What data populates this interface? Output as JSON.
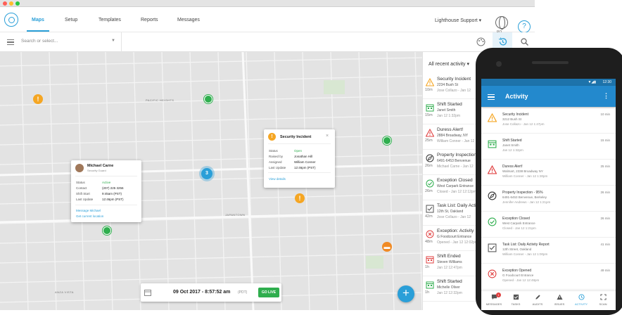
{
  "nav": {
    "items": [
      "Maps",
      "Setup",
      "Templates",
      "Reports",
      "Messages"
    ],
    "org": "Lighthouse Support",
    "globe_label": "PO",
    "help": "?"
  },
  "search": {
    "placeholder": "Search or select..."
  },
  "map": {
    "labels": [
      "PACIFIC HEIGHTS",
      "JAPANTOWN",
      "ANZA VISTA"
    ],
    "cluster_count": "3",
    "incident_popup": {
      "title": "Security Incident",
      "rows": [
        {
          "label": "Status",
          "value": "Open"
        },
        {
          "label": "Raised by",
          "value": "Jonathan Hill"
        },
        {
          "label": "Assigned",
          "value": "William Conner"
        },
        {
          "label": "Last Update",
          "value": "12:46pm (PST)"
        }
      ],
      "link": "View details"
    },
    "person_popup": {
      "name": "Michael Carne",
      "role": "Security Guard",
      "rows": [
        {
          "label": "Status",
          "value": "Active"
        },
        {
          "label": "Contact",
          "value": "(207) 225 3256"
        },
        {
          "label": "Shift Start",
          "value": "9:45am (PST)"
        },
        {
          "label": "Last Update",
          "value": "12:46pm (PST)"
        }
      ],
      "links": [
        "Message Michael",
        "Get current location"
      ]
    },
    "timebar": {
      "date": "09 Oct 2017 - 8:57:52 am",
      "tz": "(PDT)",
      "button": "GO LIVE"
    },
    "fab": "+"
  },
  "activity": {
    "filter": "All recent activity",
    "items": [
      {
        "icon": "warning",
        "color": "#f5a623",
        "title": "Security Incident",
        "sub": "2234 Bush St",
        "sub2": "Jose Collazo - Jan 12",
        "time": "10m"
      },
      {
        "icon": "shift",
        "color": "#2fae4e",
        "title": "Shift Started",
        "sub": "Janet Smith",
        "sub2": "Jan 12 1:32pm",
        "time": "15m"
      },
      {
        "icon": "warning",
        "color": "#e04040",
        "title": "Duress Alert!",
        "sub": "2884 Broadway, NY",
        "sub2": "William Conner - Jan 12",
        "time": "25m"
      },
      {
        "icon": "compass",
        "color": "#333333",
        "title": "Property Inspection",
        "sub": "6491-6453 Benvenue",
        "sub2": "Michael Carne - Jan 12",
        "time": "26m"
      },
      {
        "icon": "check-circle",
        "color": "#2fae4e",
        "title": "Exception Closed",
        "sub": "West Carpark Entrance",
        "sub2": "Closed - Jan 12 12:12pm",
        "time": "26m"
      },
      {
        "icon": "checkbox",
        "color": "#555555",
        "title": "Task List: Daily Activity",
        "sub": "12th St, Oakland",
        "sub2": "Jose Collazo - Jan 12",
        "time": "42m"
      },
      {
        "icon": "x-circle",
        "color": "#e04040",
        "title": "Exception: Activity",
        "sub": "G Foodcourt Entrance",
        "sub2": "Opened - Jan 12 12:02pm",
        "time": "48m"
      },
      {
        "icon": "shift",
        "color": "#e04040",
        "title": "Shift Ended",
        "sub": "Steven Williams",
        "sub2": "Jan 12 12:47pm",
        "time": "1h"
      },
      {
        "icon": "shift",
        "color": "#2fae4e",
        "title": "Shift Started",
        "sub": "Michelle Oliver",
        "sub2": "Jan 12 12:32pm",
        "time": "1h"
      }
    ]
  },
  "mobile": {
    "clock": "12:30",
    "title": "Activity",
    "items": [
      {
        "icon": "warning",
        "color": "#f5a623",
        "title": "Security Incident",
        "sub": "3212 Bush St",
        "sub2": "Jose Collazo - Jan 12 1:47pm",
        "time": "10 min"
      },
      {
        "icon": "shift",
        "color": "#2fae4e",
        "title": "Shift Started",
        "sub": "Janet Smith",
        "sub2": "Jan 12 1:32pm",
        "time": "15 min"
      },
      {
        "icon": "warning",
        "color": "#e04040",
        "title": "Duress Alert!",
        "sub": "Walmart, 2338 Broadway NY",
        "sub2": "William Conner - Jan 12 1:30pm",
        "time": "25 min"
      },
      {
        "icon": "compass",
        "color": "#333333",
        "title": "Property Inspection - 95%",
        "sub": "6491-6453 Benvenue, Berkeley",
        "sub2": "Jennifer Andrews - Jan 12 1:21pm",
        "time": "26 min"
      },
      {
        "icon": "check-circle",
        "color": "#2fae4e",
        "title": "Exception Closed",
        "sub": "West Carpark Entrance",
        "sub2": "Closed - Jan 12 1:21pm",
        "time": "26 min"
      },
      {
        "icon": "checkbox",
        "color": "#555555",
        "title": "Task List: Daily Activity Report",
        "sub": "12th Street, Oakland",
        "sub2": "William Conner - Jan 12 1:00pm",
        "time": "41 min"
      },
      {
        "icon": "x-circle",
        "color": "#e04040",
        "title": "Exception Opened",
        "sub": "G Foodcourt Entrance",
        "sub2": "Opened - Jan 12 12:48pm",
        "time": "49 min"
      }
    ],
    "bottom_nav": [
      {
        "icon": "messages-icon",
        "label": "MESSAGES",
        "badge": "1"
      },
      {
        "icon": "tasks-icon",
        "label": "TASKS"
      },
      {
        "icon": "audits-icon",
        "label": "AUDITS"
      },
      {
        "icon": "issues-icon",
        "label": "ISSUES"
      },
      {
        "icon": "activity-icon",
        "label": "ACTIVITY",
        "active": true
      },
      {
        "icon": "scan-icon",
        "label": "SCAN"
      }
    ]
  },
  "colors": {
    "accent": "#2a9fd8",
    "success": "#2fae4e",
    "warning": "#f5a623",
    "danger": "#e04040",
    "app_bar": "#2389cd"
  }
}
